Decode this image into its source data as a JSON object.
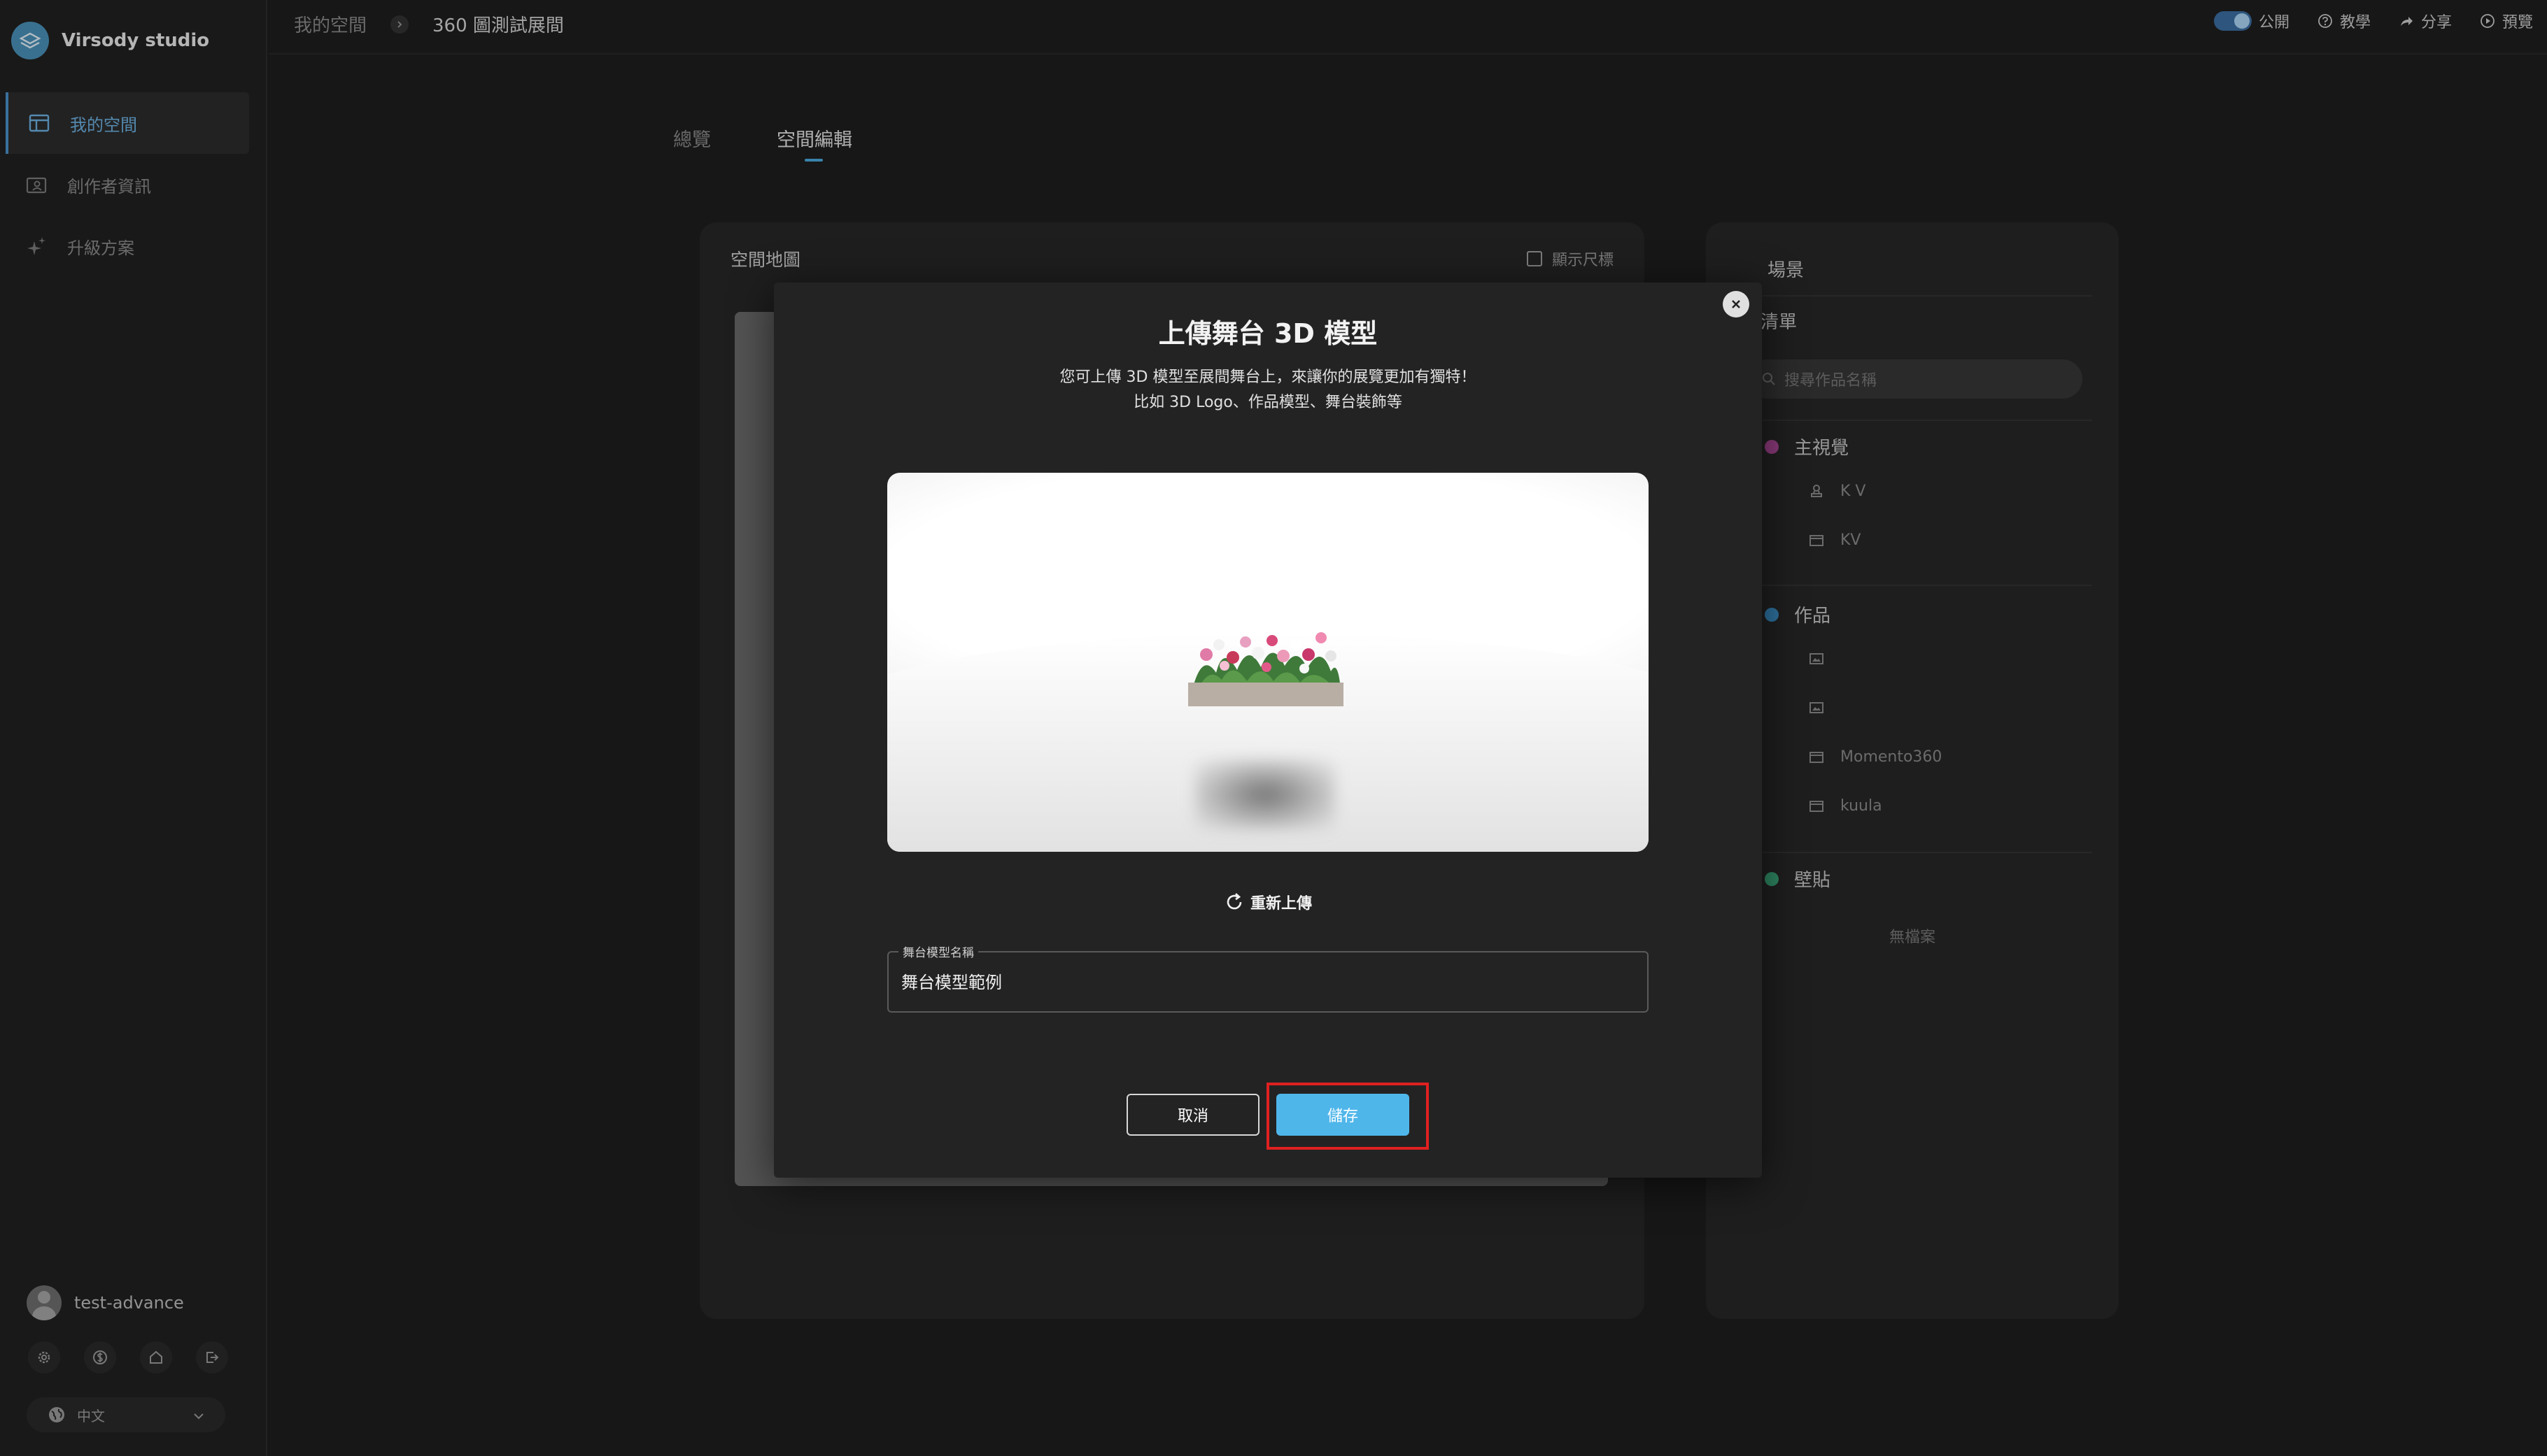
{
  "app": {
    "brand": "Virsody studio"
  },
  "sidebar": {
    "items": [
      {
        "label": "我的空間",
        "icon": "layout-icon",
        "active": true
      },
      {
        "label": "創作者資訊",
        "icon": "profile-card-icon",
        "active": false
      },
      {
        "label": "升級方案",
        "icon": "sparkle-icon",
        "active": false
      }
    ],
    "user": {
      "name": "test-advance"
    },
    "bottom_icons": [
      "gear-icon",
      "dollar-icon",
      "home-icon",
      "logout-icon"
    ],
    "language": "中文"
  },
  "header": {
    "breadcrumb": [
      "我的空間",
      "360 圖測試展間"
    ],
    "public_label": "公開",
    "tutorial_label": "教學",
    "share_label": "分享",
    "preview_label": "預覽"
  },
  "tabs": [
    {
      "label": "總覽",
      "active": false
    },
    {
      "label": "空間編輯",
      "active": true
    }
  ],
  "map_panel": {
    "title": "空間地圖",
    "show_size_label": "顯示尺標"
  },
  "right_panel": {
    "scene_label": "場景",
    "list_title": "品清單",
    "search_placeholder": "搜尋作品名稱",
    "groups": [
      {
        "label": "主視覺",
        "color": "#b04a9a",
        "items": [
          {
            "icon": "stamp-icon",
            "label": "K V"
          },
          {
            "icon": "frame-icon",
            "label": "KV"
          }
        ]
      },
      {
        "label": "作品",
        "color": "#3a8fc8",
        "items": [
          {
            "icon": "image-icon",
            "label": ""
          },
          {
            "icon": "image-icon",
            "label": ""
          },
          {
            "icon": "panorama-icon",
            "label": "Momento360"
          },
          {
            "icon": "panorama-icon",
            "label": "kuula"
          }
        ]
      },
      {
        "label": "壁貼",
        "color": "#3aa87a",
        "items": []
      }
    ],
    "empty_label": "無檔案"
  },
  "modal": {
    "title": "上傳舞台 3D 模型",
    "description_line1": "您可上傳 3D 模型至展間舞台上，來讓你的展覽更加有獨特！",
    "description_line2": "比如 3D Logo、作品模型、舞台裝飾等",
    "reupload_label": "重新上傳",
    "field_label": "舞台模型名稱",
    "field_value": "舞台模型範例",
    "cancel_label": "取消",
    "save_label": "儲存"
  }
}
